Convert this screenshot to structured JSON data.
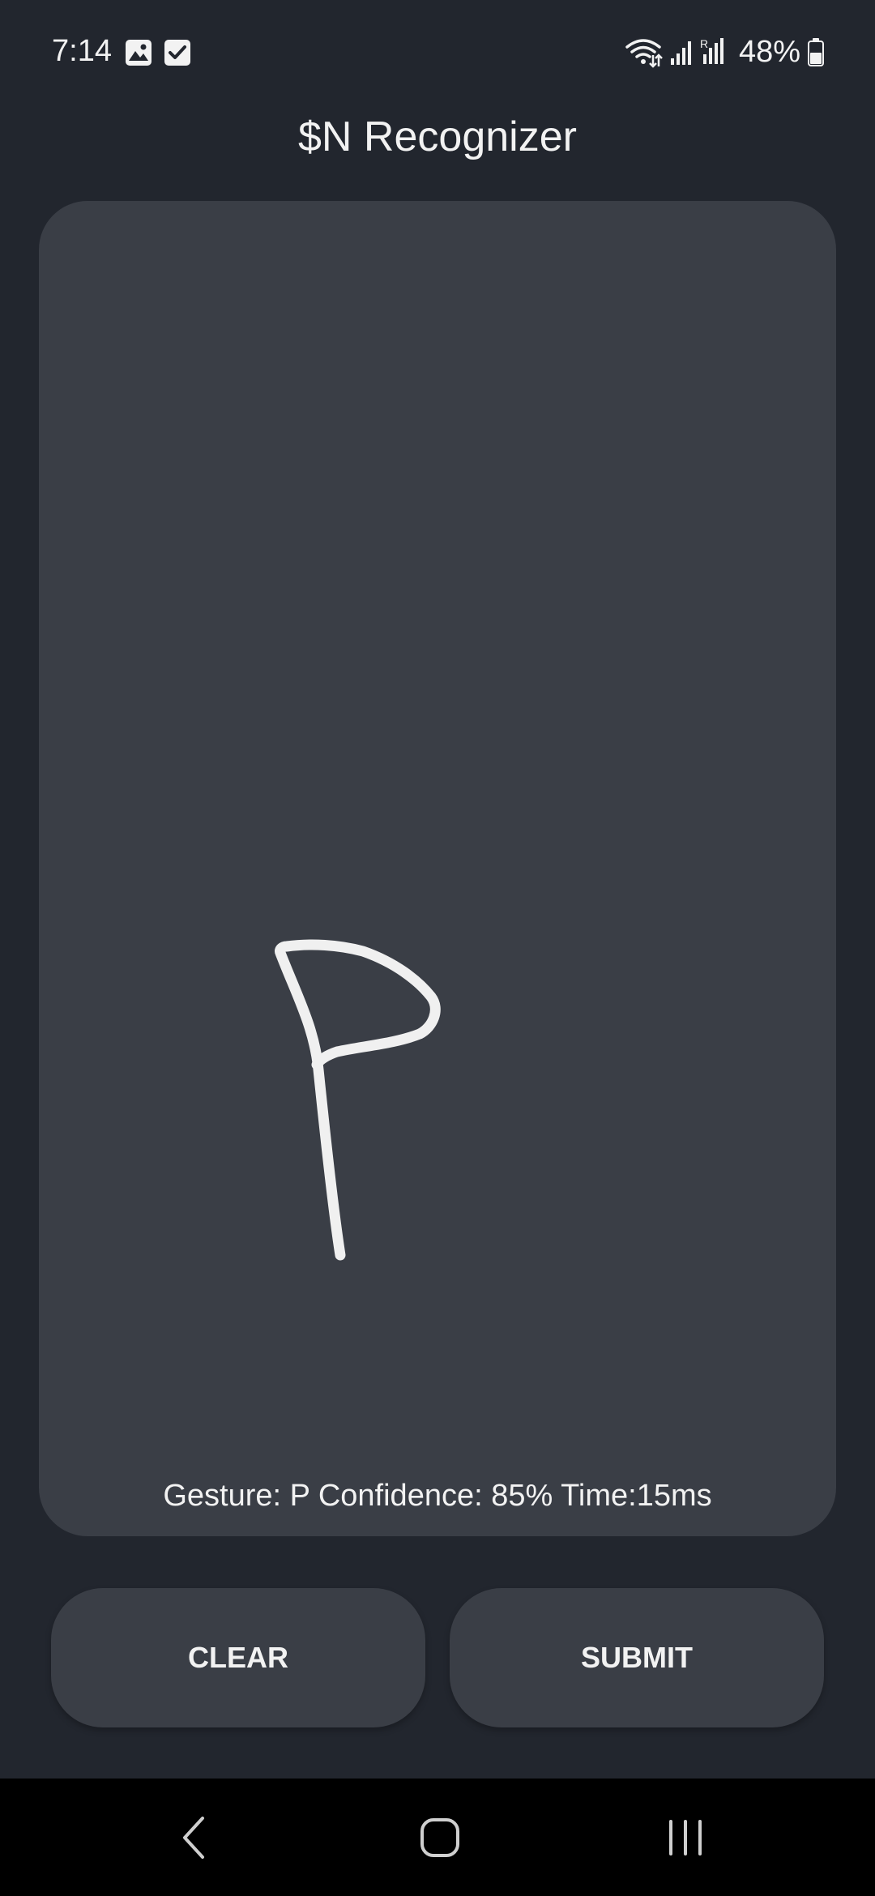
{
  "status_bar": {
    "time": "7:14",
    "left_icons": [
      "image-icon",
      "checkbox-icon"
    ],
    "right_icons": [
      "wifi-icon",
      "signal-icon",
      "signal-roaming-icon",
      "battery-icon"
    ],
    "battery": "48%"
  },
  "app": {
    "title": "$N Recognizer"
  },
  "canvas": {
    "background": "#3a3e46",
    "stroke_color": "#f0f0f0",
    "result": "Gesture: P Confidence: 85% Time:15ms"
  },
  "buttons": {
    "clear": "CLEAR",
    "submit": "SUBMIT"
  },
  "navigation": {
    "items": [
      "back-icon",
      "home-icon",
      "recents-icon"
    ]
  },
  "colors": {
    "background": "#22262e",
    "surface": "#3a3e46",
    "text": "#f2f2f2",
    "nav_bar": "#000000"
  }
}
